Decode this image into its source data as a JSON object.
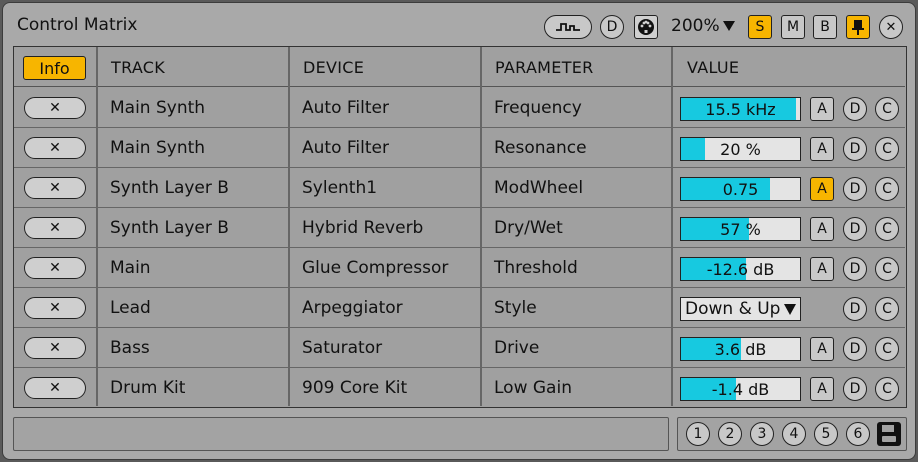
{
  "window": {
    "title": "Control Matrix",
    "zoom": "200%",
    "toggle_s": "S",
    "toggle_m": "M",
    "toggle_b": "B",
    "btn_d": "D",
    "close": "✕"
  },
  "table": {
    "info_label": "Info",
    "headers": [
      "TRACK",
      "DEVICE",
      "PARAMETER",
      "VALUE"
    ],
    "rows": [
      {
        "remove": "✕",
        "track": "Main Synth",
        "device": "Auto Filter",
        "parameter": "Frequency",
        "value": "15.5 kHz",
        "fill": 0.97,
        "a": "A",
        "a_active": false,
        "d": "D",
        "c": "C"
      },
      {
        "remove": "✕",
        "track": "Main Synth",
        "device": "Auto Filter",
        "parameter": "Resonance",
        "value": "20 %",
        "fill": 0.2,
        "a": "A",
        "a_active": false,
        "d": "D",
        "c": "C"
      },
      {
        "remove": "✕",
        "track": "Synth Layer B",
        "device": "Sylenth1",
        "parameter": "ModWheel",
        "value": "0.75",
        "fill": 0.75,
        "a": "A",
        "a_active": true,
        "d": "D",
        "c": "C"
      },
      {
        "remove": "✕",
        "track": "Synth Layer B",
        "device": "Hybrid Reverb",
        "parameter": "Dry/Wet",
        "value": "57 %",
        "fill": 0.57,
        "a": "A",
        "a_active": false,
        "d": "D",
        "c": "C"
      },
      {
        "remove": "✕",
        "track": "Main",
        "device": "Glue Compressor",
        "parameter": "Threshold",
        "value": "-12.6 dB",
        "fill": 0.55,
        "a": "A",
        "a_active": false,
        "d": "D",
        "c": "C"
      },
      {
        "remove": "✕",
        "track": "Lead",
        "device": "Arpeggiator",
        "parameter": "Style",
        "value": "Down & Up",
        "dropdown": true,
        "d": "D",
        "c": "C"
      },
      {
        "remove": "✕",
        "track": "Bass",
        "device": "Saturator",
        "parameter": "Drive",
        "value": "3.6 dB",
        "fill": 0.5,
        "a": "A",
        "a_active": false,
        "d": "D",
        "c": "C"
      },
      {
        "remove": "✕",
        "track": "Drum Kit",
        "device": "909 Core Kit",
        "parameter": "Low Gain",
        "value": "-1.4 dB",
        "fill": 0.46,
        "a": "A",
        "a_active": false,
        "d": "D",
        "c": "C"
      }
    ]
  },
  "footer": {
    "slots": [
      "1",
      "2",
      "3",
      "4",
      "5",
      "6"
    ]
  },
  "colors": {
    "accent": "#f7b500",
    "bar_fill": "#17c9e0"
  }
}
